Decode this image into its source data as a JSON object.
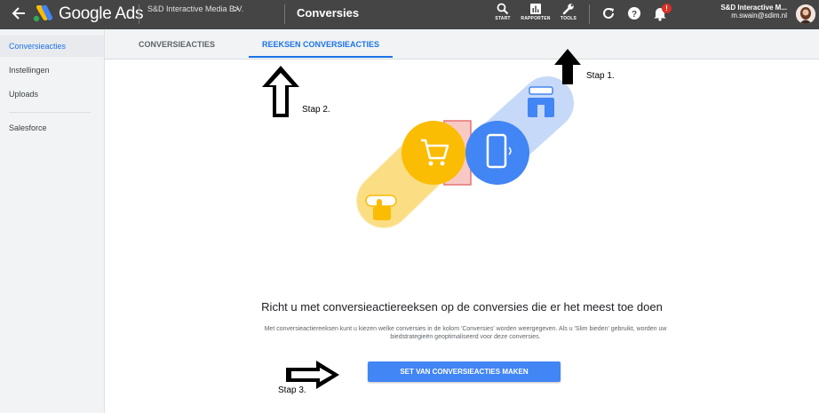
{
  "header": {
    "brand": "Google Ads",
    "account": "S&D Interactive Media B.V.",
    "account_chevron": ">",
    "page_title": "Conversies",
    "tools": [
      {
        "label": "START",
        "icon": "search-icon"
      },
      {
        "label": "RAPPORTEN",
        "icon": "reports-icon"
      },
      {
        "label": "TOOLS",
        "icon": "wrench-icon"
      }
    ],
    "user": {
      "name": "S&D Interactive M...",
      "email": "m.swain@sdim.nl"
    },
    "notification_badge": "!",
    "colors": {
      "bar": "#454545",
      "badge": "#d93025"
    }
  },
  "sidebar": {
    "items": [
      {
        "label": "Conversieacties",
        "active": true
      },
      {
        "label": "Instellingen",
        "active": false
      },
      {
        "label": "Uploads",
        "active": false
      },
      {
        "label": "Salesforce",
        "active": false
      }
    ]
  },
  "tabs": [
    {
      "label": "CONVERSIEACTIES",
      "active": false
    },
    {
      "label": "REEKSEN CONVERSIEACTIES",
      "active": true
    }
  ],
  "main": {
    "title": "Richt u met conversieactiereeksen op de conversies die er het meest toe doen",
    "description": "Met conversieactiereeksen kunt u kiezen welke conversies in de kolom 'Conversies' worden weergegeven. Als u 'Slim bieden' gebruikt, worden uw biedstrategieën geoptimaliseerd voor deze conversies.",
    "cta_label": "SET VAN CONVERSIEACTIES MAKEN",
    "accent": "#4285f4"
  },
  "annotations": {
    "step1": "Stap 1.",
    "step2": "Stap 2.",
    "step3": "Stap 3."
  }
}
